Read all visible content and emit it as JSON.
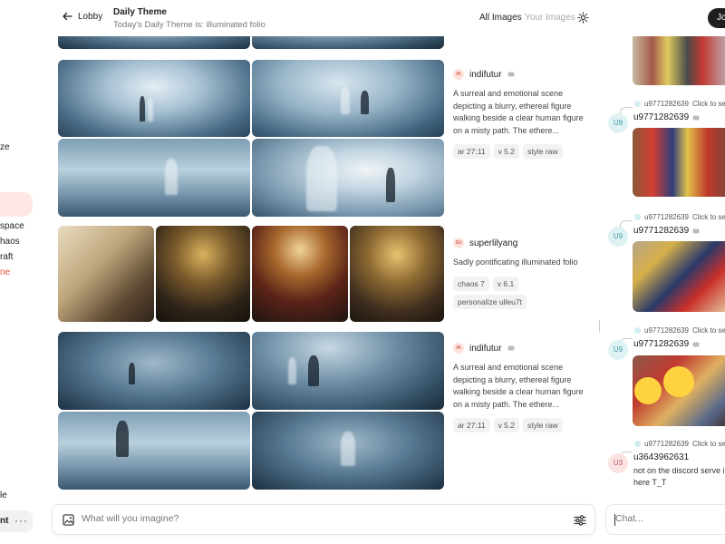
{
  "sidebar": {
    "items": [
      "ze",
      "space",
      "haos",
      "raft",
      "ne",
      "le"
    ],
    "active_index": 4,
    "bottom_label": "nt",
    "bottom_more": "···"
  },
  "header": {
    "back_label": "Lobby",
    "title": "Daily Theme",
    "subtitle": "Today's Daily Theme is: illuminated folio",
    "tab_all": "All Images",
    "tab_yours": "Your Images",
    "join_label": "Jo"
  },
  "feed": {
    "posts": [
      {
        "initials": "IN",
        "username": "indifutur",
        "prompt": "A surreal and emotional scene depicting a blurry, ethereal figure walking beside a clear human figure on a misty path. The ethere...",
        "chips": [
          "ar 27:11",
          "v 5.2",
          "style raw"
        ]
      },
      {
        "initials": "SU",
        "username": "superlilyang",
        "prompt": "Sadly pontificating illuminated folio",
        "chips": [
          "chaos 7",
          "v 6.1",
          "personalize ulleu7t"
        ]
      },
      {
        "initials": "IN",
        "username": "indifutur",
        "prompt": "A surreal and emotional scene depicting a blurry, ethereal figure walking beside a clear human figure on a misty path. The ethere...",
        "chips": [
          "ar 27:11",
          "v 5.2",
          "style raw"
        ]
      }
    ]
  },
  "chat": {
    "messages": [
      {
        "reply_user": "u9771282639",
        "reply_text": "Click to se",
        "avatar": "U9",
        "username": "u9771282639"
      },
      {
        "reply_user": "u9771282639",
        "reply_text": "Click to se",
        "avatar": "U9",
        "username": "u9771282639"
      },
      {
        "reply_user": "u9771282639",
        "reply_text": "Click to se",
        "avatar": "U9",
        "username": "u9771282639"
      },
      {
        "reply_user": "u9771282639",
        "reply_text": "Click to se",
        "avatar": "U3",
        "username": "u3643962631",
        "text": "not on the discord serve in here T_T"
      }
    ]
  },
  "prompt_bar": {
    "placeholder": "What will you imagine?"
  },
  "chat_bar": {
    "placeholder": "Chat..."
  },
  "colors": {
    "accent": "#e5533d",
    "join_bg": "#1f1f1f",
    "teal": "#3a9aa3"
  }
}
